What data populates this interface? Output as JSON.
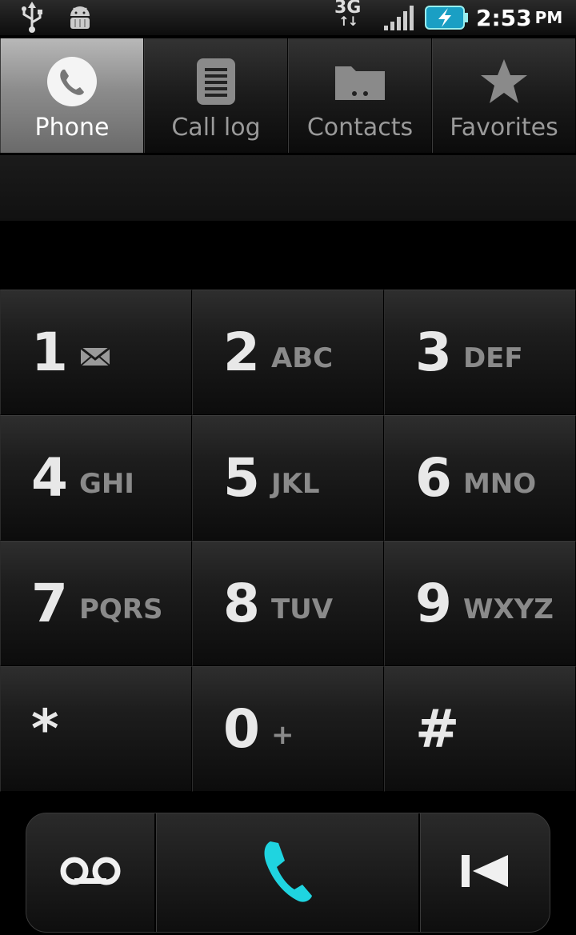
{
  "status_bar": {
    "network": "3G",
    "time": "2:53",
    "ampm": "PM",
    "icons": [
      "usb-icon",
      "android-debug-icon",
      "signal-icon",
      "battery-charging-icon"
    ]
  },
  "tabs": [
    {
      "label": "Phone",
      "icon": "phone-icon",
      "active": true
    },
    {
      "label": "Call log",
      "icon": "call-log-icon",
      "active": false
    },
    {
      "label": "Contacts",
      "icon": "contacts-folder-icon",
      "active": false
    },
    {
      "label": "Favorites",
      "icon": "star-icon",
      "active": false
    }
  ],
  "keypad": [
    {
      "digit": "1",
      "letters": "",
      "icon": "voicemail-envelope-icon"
    },
    {
      "digit": "2",
      "letters": "ABC"
    },
    {
      "digit": "3",
      "letters": "DEF"
    },
    {
      "digit": "4",
      "letters": "GHI"
    },
    {
      "digit": "5",
      "letters": "JKL"
    },
    {
      "digit": "6",
      "letters": "MNO"
    },
    {
      "digit": "7",
      "letters": "PQRS"
    },
    {
      "digit": "8",
      "letters": "TUV"
    },
    {
      "digit": "9",
      "letters": "WXYZ"
    },
    {
      "digit": "*",
      "letters": ""
    },
    {
      "digit": "0",
      "letters": "+"
    },
    {
      "digit": "#",
      "letters": ""
    }
  ],
  "actions": {
    "voicemail_icon": "voicemail-icon",
    "call_icon": "call-icon",
    "delete_icon": "backspace-icon",
    "call_color": "#1fd4e0"
  }
}
